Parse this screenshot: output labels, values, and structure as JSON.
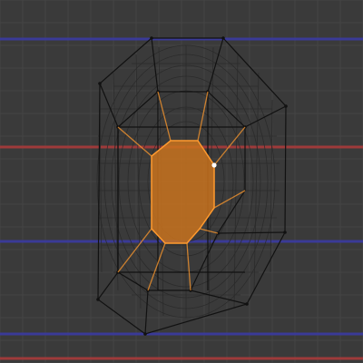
{
  "viewport": {
    "background": "#3a3a3a",
    "grid_color": "#444444",
    "axis_x_color": "#b03a3a",
    "axis_y_color": "#3a3aa8"
  },
  "mesh": {
    "wire_color": "#111111",
    "subdiv_wire_color": "#2a2a2a",
    "selected_face_color": "#c9731f",
    "selected_edge_color": "#ff9a2e",
    "active_vertex_color": "#ffffff"
  }
}
